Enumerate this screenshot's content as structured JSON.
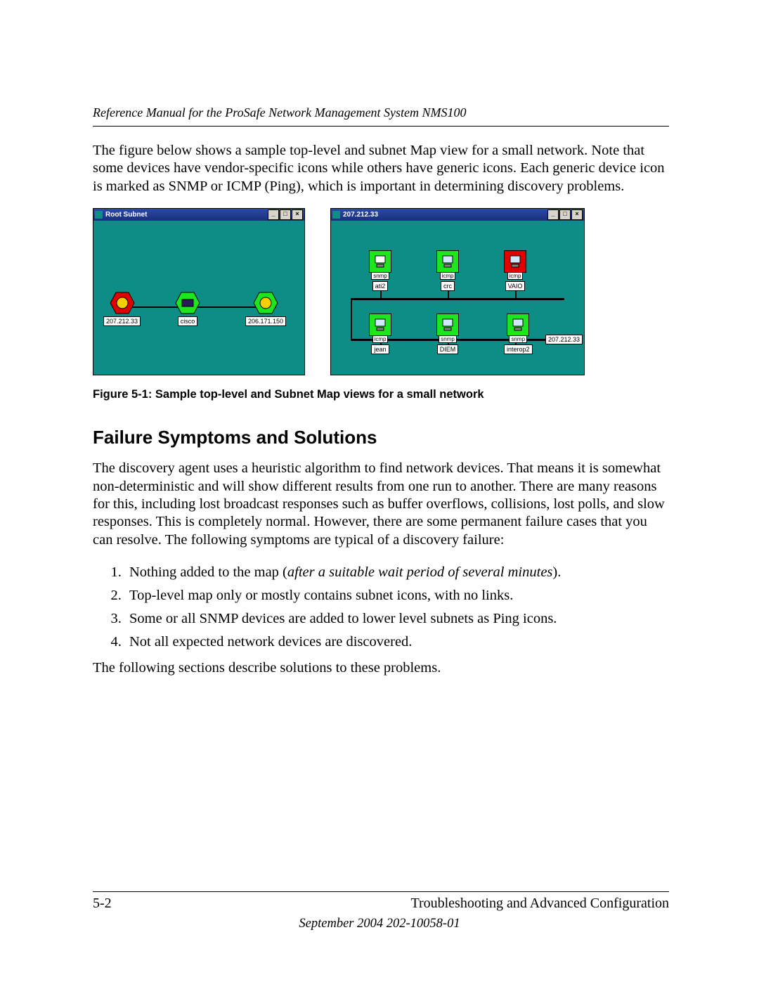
{
  "header": {
    "running_title": "Reference Manual for the ProSafe Network Management System NMS100"
  },
  "intro_paragraph": "The figure below shows a sample top-level and subnet Map view for a small network. Note that some devices have vendor-specific icons while others have generic icons. Each generic device icon is marked as SNMP or ICMP (Ping), which is important in determining discovery problems.",
  "figure": {
    "left_window": {
      "title": "Root Subnet",
      "nodes": [
        {
          "label": "207.212.33",
          "color": "red"
        },
        {
          "label": "cisco",
          "color": "green"
        },
        {
          "label": "206.171.150",
          "color": "green"
        }
      ]
    },
    "right_window": {
      "title": "207.212.33",
      "top_row": [
        {
          "name": "ati2",
          "tag": "snmp",
          "status": "green"
        },
        {
          "name": "crc",
          "tag": "icmp",
          "status": "green"
        },
        {
          "name": "VAIO",
          "tag": "icmp",
          "status": "red"
        }
      ],
      "bottom_row": [
        {
          "name": "jean",
          "tag": "icmp",
          "status": "green"
        },
        {
          "name": "DIEM",
          "tag": "snmp",
          "status": "green"
        },
        {
          "name": "interop2",
          "tag": "snmp",
          "status": "green"
        }
      ],
      "side_label": "207.212.33"
    },
    "caption": "Figure 5-1:  Sample top-level and Subnet Map views for a small network"
  },
  "section_heading": "Failure Symptoms and Solutions",
  "section_paragraph": "The discovery agent uses a heuristic algorithm to find network devices. That means it is somewhat non-deterministic and will show different results from one run to another. There are many reasons for this, including lost broadcast responses such as buffer overflows, collisions, lost polls, and slow responses. This is completely normal. However, there are some permanent failure cases that you can resolve. The following symptoms are typical of a discovery failure:",
  "symptoms": {
    "item1_prefix": "Nothing added to the map (",
    "item1_italic": "after a suitable wait period of several minutes",
    "item1_suffix": ").",
    "item2": "Top-level map only or mostly contains subnet icons, with no links.",
    "item3": "Some or all SNMP devices are added to lower level subnets as Ping icons.",
    "item4": "Not all expected network devices are discovered."
  },
  "closing_paragraph": "The following sections describe solutions to these problems.",
  "footer": {
    "page_number": "5-2",
    "chapter": "Troubleshooting and Advanced Configuration",
    "date_line": "September 2004 202-10058-01"
  }
}
